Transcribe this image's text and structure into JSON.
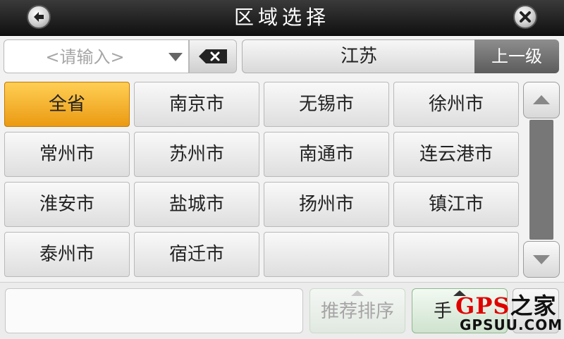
{
  "header": {
    "title": "区域选择",
    "back_icon": "back-arrow-icon",
    "close_icon": "close-x-icon"
  },
  "search": {
    "placeholder": "<请输入>",
    "value": "",
    "clear_icon": "backspace-clear-icon"
  },
  "province": {
    "current": "江苏",
    "parent_label": "上一级"
  },
  "cities": [
    {
      "label": "全省",
      "selected": true
    },
    {
      "label": "南京市",
      "selected": false
    },
    {
      "label": "无锡市",
      "selected": false
    },
    {
      "label": "徐州市",
      "selected": false
    },
    {
      "label": "常州市",
      "selected": false
    },
    {
      "label": "苏州市",
      "selected": false
    },
    {
      "label": "南通市",
      "selected": false
    },
    {
      "label": "连云港市",
      "selected": false
    },
    {
      "label": "淮安市",
      "selected": false
    },
    {
      "label": "盐城市",
      "selected": false
    },
    {
      "label": "扬州市",
      "selected": false
    },
    {
      "label": "镇江市",
      "selected": false
    },
    {
      "label": "泰州市",
      "selected": false
    },
    {
      "label": "宿迁市",
      "selected": false
    },
    {
      "label": "",
      "selected": false
    },
    {
      "label": "",
      "selected": false
    }
  ],
  "footer": {
    "sort_recommend_label": "推荐排序",
    "sort_manual_label": "手",
    "watermark_main": "GPS",
    "watermark_zh": "之家",
    "watermark_sub": "GPSUU.COM"
  },
  "colors": {
    "selected": "#eb9a12",
    "titlebar": "#1a1a1a"
  }
}
